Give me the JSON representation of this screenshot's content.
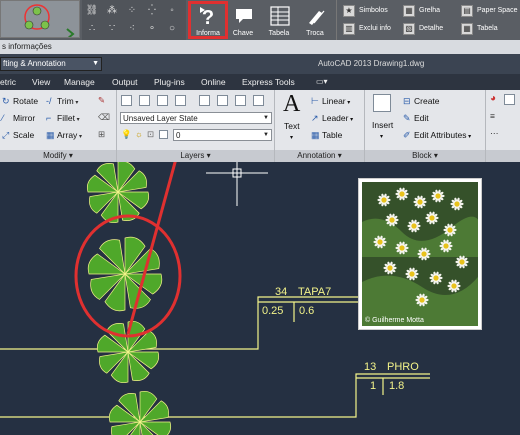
{
  "toolbar": {
    "tools": [
      {
        "label": "Informa",
        "icon": "question-icon"
      },
      {
        "label": "Chave",
        "icon": "speech-bubble-icon"
      },
      {
        "label": "Tabela",
        "icon": "table-icon"
      },
      {
        "label": "Troca",
        "icon": "swap-icon"
      }
    ],
    "right_tools": [
      {
        "label": "Simbolos",
        "icon": "star-icon"
      },
      {
        "label": "Grelha",
        "icon": "grid-icon"
      },
      {
        "label": "Paper Space",
        "icon": "paper-space-icon"
      },
      {
        "label": "Exclui info",
        "icon": "delete-info-icon"
      },
      {
        "label": "Detalhe",
        "icon": "detail-icon"
      },
      {
        "label": "Tabela",
        "icon": "table-icon"
      }
    ]
  },
  "info_bar": {
    "text": "s informações"
  },
  "title_bar": {
    "workspace": "fting & Annotation",
    "title": "AutoCAD 2013     Drawing1.dwg"
  },
  "ribbon_tabs": [
    "etric",
    "View",
    "Manage",
    "Output",
    "Plug-ins",
    "Online",
    "Express Tools"
  ],
  "ribbon": {
    "modify": {
      "title": "Modify",
      "items": [
        "Rotate",
        "Trim",
        "Mirror",
        "Fillet",
        "Scale",
        "Array"
      ]
    },
    "layers": {
      "title": "Layers",
      "state": "Unsaved Layer State",
      "current": "0"
    },
    "annotation": {
      "title": "Annotation",
      "text_label": "Text",
      "items": [
        "Linear",
        "Leader",
        "Table"
      ]
    },
    "block": {
      "title": "Block",
      "insert_label": "Insert",
      "items": [
        "Create",
        "Edit",
        "Edit Attributes"
      ]
    }
  },
  "drawing": {
    "photo_credit": "© Guilherme Motta",
    "labels": [
      {
        "code": "34",
        "name": "TAPA7",
        "v1": "0.25",
        "v2": "0.6"
      },
      {
        "code": "13",
        "name": "PHRO",
        "v1": "1",
        "v2": "1.8"
      }
    ]
  },
  "colors": {
    "annotation_red": "#e03030",
    "drawing_bg": "#253042",
    "line_yellow": "#f3f38a",
    "plant_green": "#4fa82a"
  }
}
